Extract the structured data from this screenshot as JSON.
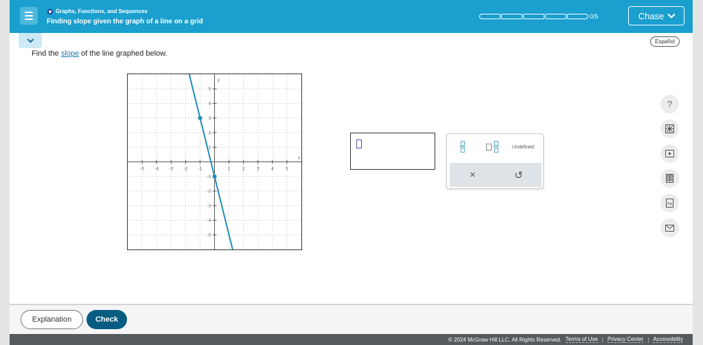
{
  "header": {
    "topic": "Graphs, Functions, and Sequences",
    "lesson_title": "Finding slope given the graph of a line on a grid",
    "progress_count": "0/5",
    "progress_segments": 5,
    "user_name": "Chase"
  },
  "language_button": "Español",
  "prompt": {
    "before": "Find the ",
    "link": "slope",
    "after": " of the line graphed below."
  },
  "graph": {
    "x_range": [
      -6,
      6
    ],
    "y_range": [
      -6,
      6
    ],
    "x_ticks": [
      "-5",
      "-4",
      "-3",
      "-2",
      "-1",
      "1",
      "2",
      "3",
      "4",
      "5"
    ],
    "y_ticks": [
      "5",
      "4",
      "3",
      "2",
      "1",
      "-1",
      "-2",
      "-3",
      "-4",
      "-5"
    ],
    "x_axis_label": "x",
    "y_axis_label": "y",
    "points": [
      {
        "x": -1,
        "y": 3
      },
      {
        "x": 0,
        "y": -1
      }
    ],
    "line_color": "#1f8db5"
  },
  "keypad": {
    "undefined_label": "Undefined",
    "clear_symbol": "×",
    "undo_symbol": "↺",
    "icons": [
      "fraction-icon",
      "mixed-number-icon"
    ]
  },
  "rail": {
    "help_symbol": "?",
    "icons": [
      "help-icon",
      "calculator-icon",
      "video-icon",
      "periodic-table-icon",
      "dictionary-icon",
      "mail-icon"
    ]
  },
  "bottom": {
    "explanation_label": "Explanation",
    "check_label": "Check"
  },
  "legal": {
    "copyright": "© 2024 McGraw Hill LLC. All Rights Reserved.",
    "terms": "Terms of Use",
    "privacy": "Privacy Center",
    "accessibility": "Accessibility",
    "separator": "|"
  },
  "colors": {
    "header_bg": "#1a9fce",
    "check_bg": "#075c82",
    "footer_bg": "#575a5c"
  }
}
